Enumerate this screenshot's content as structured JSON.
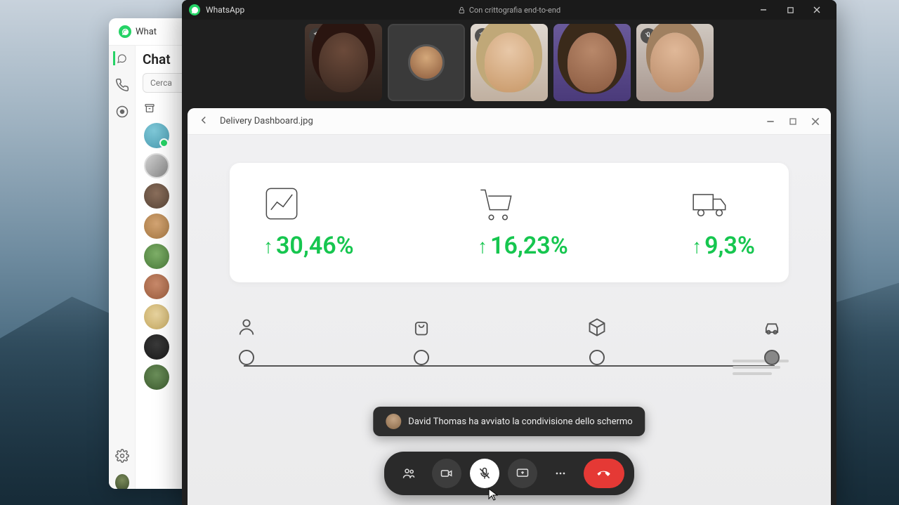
{
  "whatsapp_main": {
    "app_name": "What",
    "sidebar_title": "Chat",
    "search_placeholder": "Cerca",
    "archive_label": ""
  },
  "call_window": {
    "app_name": "WhatsApp",
    "encryption_text": "Con crittografia end-to-end",
    "participants": [
      {
        "muted": true,
        "video": true,
        "name": "participant-1"
      },
      {
        "muted": false,
        "video": false,
        "name": "participant-self"
      },
      {
        "muted": true,
        "video": true,
        "name": "participant-3"
      },
      {
        "muted": false,
        "video": true,
        "name": "participant-4"
      },
      {
        "muted": true,
        "video": true,
        "name": "participant-5"
      }
    ]
  },
  "shared_screen": {
    "title": "Delivery Dashboard.jpg",
    "kpis": [
      {
        "icon": "chart-icon",
        "value": "30,46%"
      },
      {
        "icon": "cart-icon",
        "value": "16,23%"
      },
      {
        "icon": "truck-icon",
        "value": "9,3%"
      }
    ],
    "steps": [
      {
        "icon": "person-icon",
        "active": false
      },
      {
        "icon": "bag-icon",
        "active": false
      },
      {
        "icon": "package-icon",
        "active": false
      },
      {
        "icon": "car-icon",
        "active": true
      }
    ]
  },
  "toast": {
    "text": "David Thomas ha avviato la condivisione dello schermo"
  },
  "controls": {
    "people": "people-icon",
    "video": "video-icon",
    "mic": "mic-off-icon",
    "screen": "screen-share-icon",
    "more": "more-icon",
    "end": "end-call-icon"
  }
}
